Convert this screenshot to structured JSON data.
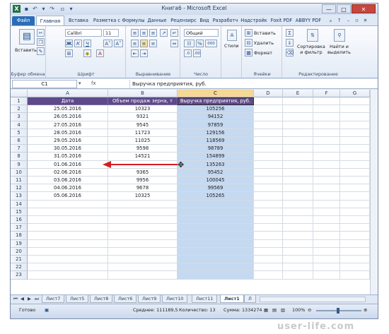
{
  "window": {
    "title": "Книга6 - Microsoft Excel",
    "min": "—",
    "max": "□",
    "close": "✕"
  },
  "tabs": {
    "file": "Файл",
    "items": [
      "Главная",
      "Вставка",
      "Разметка с",
      "Формулы",
      "Данные",
      "Рецензирс",
      "Вид",
      "Разработч",
      "Надстройк",
      "Foxit PDF",
      "ABBYY PDF"
    ]
  },
  "ribbon": {
    "clipboard": {
      "paste": "Вставить",
      "label": "Буфер обмена"
    },
    "font": {
      "name": "Calibri",
      "size": "11",
      "bold": "Ж",
      "italic": "К",
      "underline": "Ч",
      "grow": "A˄",
      "shrink": "A˅",
      "label": "Шрифт"
    },
    "align": {
      "label": "Выравнивание"
    },
    "number": {
      "format": "Общий",
      "pct": "%",
      "thousands": "000",
      "label": "Число"
    },
    "styles": {
      "btn": "Стили",
      "label": ""
    },
    "cells": {
      "insert": "Вставить",
      "delete": "Удалить",
      "format": "Формат",
      "label": "Ячейки"
    },
    "edit": {
      "sort": "Сортировка\nи фильтр",
      "find": "Найти и\nвыделить",
      "sum": "Σ",
      "label": "Редактирование"
    }
  },
  "formula": {
    "namebox": "C1",
    "fx": "fx",
    "content": "Выручка предприятия, руб."
  },
  "columns": [
    "A",
    "B",
    "C",
    "D",
    "E",
    "F",
    "G"
  ],
  "header": [
    "Дата",
    "Объем продаж зерна, т",
    "Выручка предприятия, руб."
  ],
  "rows": [
    [
      "25.05.2016",
      "10323",
      "105256"
    ],
    [
      "26.05.2016",
      "9321",
      "94152"
    ],
    [
      "27.05.2016",
      "9545",
      "97859"
    ],
    [
      "28.05.2016",
      "11723",
      "129156"
    ],
    [
      "29.05.2016",
      "11025",
      "118569"
    ],
    [
      "30.05.2016",
      "9598",
      "98789"
    ],
    [
      "31.05.2016",
      "14521",
      "154899"
    ],
    [
      "01.06.2016",
      "",
      "135263"
    ],
    [
      "02.06.2016",
      "9365",
      "95452"
    ],
    [
      "03.06.2016",
      "9956",
      "100045"
    ],
    [
      "04.06.2016",
      "9678",
      "99569"
    ],
    [
      "05.06.2016",
      "10325",
      "105265"
    ]
  ],
  "rowcount": 23,
  "sheets": [
    "Лист7",
    "Лист5",
    "Лист8",
    "Лист6",
    "Лист9",
    "Лист10",
    "Лист11",
    "Лист1",
    "Л"
  ],
  "status": {
    "ready": "Готово",
    "avg": "Среднее: 111189,5",
    "count": "Количество: 13",
    "sum": "Сумма: 1334274",
    "zoom": "100%"
  },
  "watermark": "user-life.com"
}
